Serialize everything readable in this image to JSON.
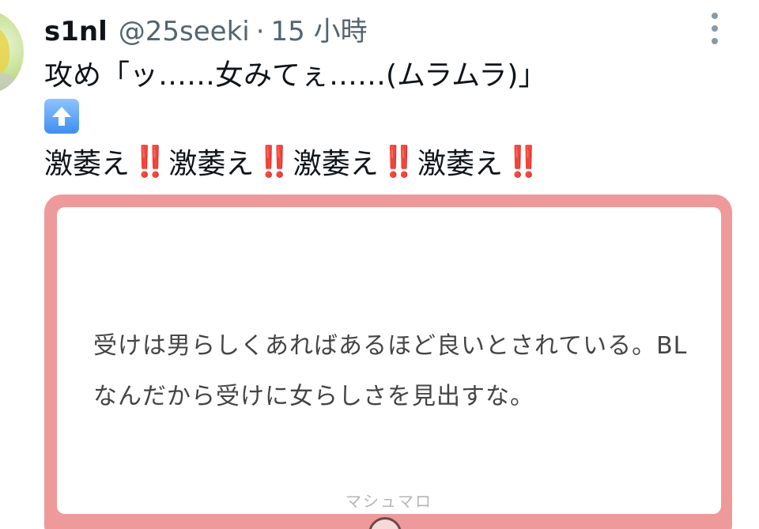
{
  "tweet": {
    "display_name": "s1nl",
    "handle": "@25seeki",
    "separator": "·",
    "time": "15 小時",
    "line1": "攻め「ッ……女みてぇ……(ムラムラ)」",
    "arrow_icon": "up-arrow-emoji",
    "line3_word": "激萎え",
    "line3_repeat": 4,
    "line3_punct": "‼️"
  },
  "card": {
    "question": "受けは男らしくあればあるほど良いとされている。BLなんだから受けに女らしさを見出すな。",
    "brand": "マシュマロ",
    "border_color": "#ef9a9a"
  }
}
